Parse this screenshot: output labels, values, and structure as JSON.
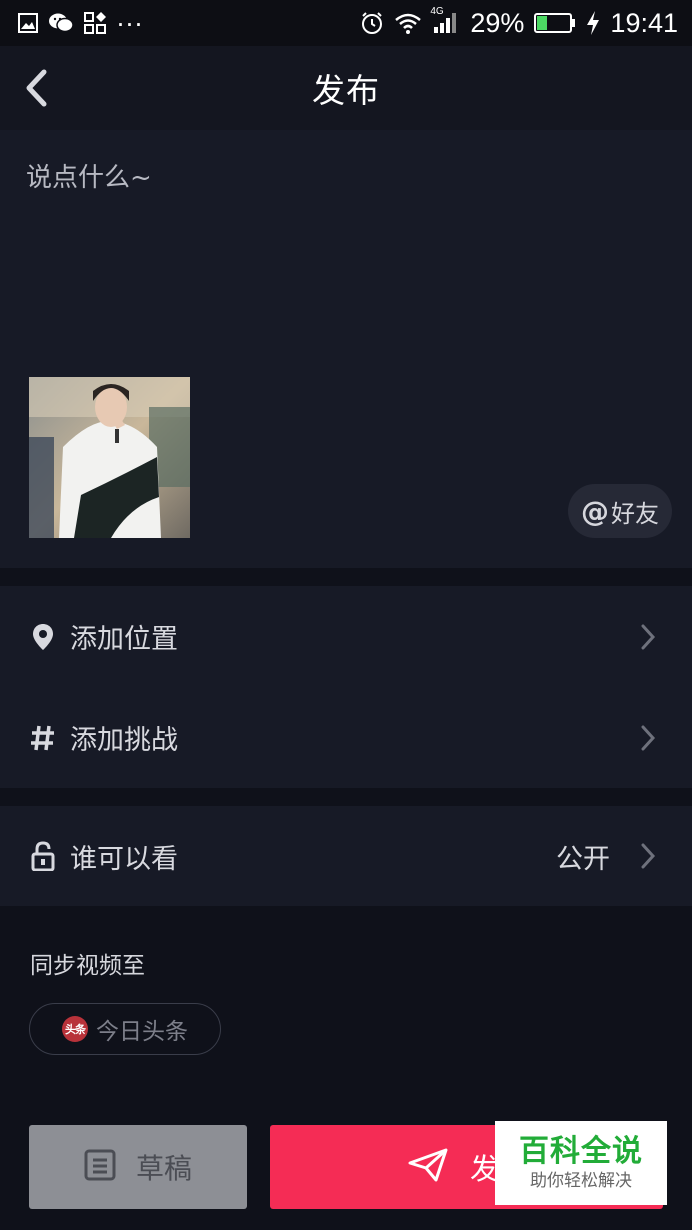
{
  "status_bar": {
    "battery_percent": "29%",
    "time": "19:41",
    "network": "4G",
    "overflow": "···",
    "icons": [
      "gallery-icon",
      "wechat-icon",
      "apps-icon",
      "alarm-icon",
      "wifi-icon",
      "signal-icon",
      "battery-icon",
      "charging-icon"
    ]
  },
  "header": {
    "title": "发布",
    "back_icon": "chevron-left-icon"
  },
  "caption": {
    "placeholder": "说点什么~",
    "value": ""
  },
  "at_friend": {
    "symbol": "@",
    "label": "好友"
  },
  "options": [
    {
      "label": "添加位置",
      "icon": "location-pin-icon"
    },
    {
      "label": "添加挑战",
      "icon": "hashtag-icon"
    }
  ],
  "privacy": {
    "label": "谁可以看",
    "value": "公开",
    "icon": "unlock-icon"
  },
  "sync": {
    "title": "同步视频至",
    "target_label": "今日头条",
    "target_logo_text": "头条"
  },
  "actions": {
    "draft_label": "草稿",
    "publish_label": "发布"
  },
  "watermark": {
    "main": "百科全说",
    "sub": "助你轻松解决"
  },
  "colors": {
    "background": "#0f111a",
    "panel": "#171a26",
    "publish": "#f52c55",
    "draft": "#8d8f95",
    "watermark_green": "#22ac38"
  }
}
